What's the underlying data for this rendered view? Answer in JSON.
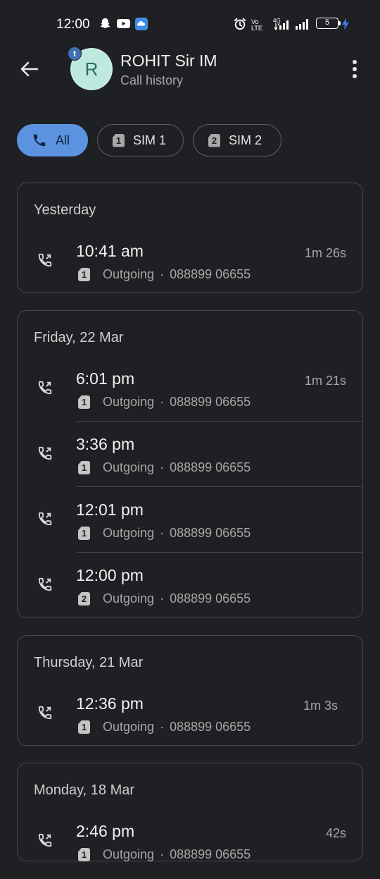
{
  "status_bar": {
    "time": "12:00",
    "network": "4G",
    "volte": "Vo LTE",
    "battery": "5"
  },
  "header": {
    "contact_name": "ROHIT Sir IM",
    "subtitle": "Call history",
    "avatar_letter": "R",
    "avatar_badge": "t"
  },
  "filters": [
    {
      "label": "All",
      "badge": ""
    },
    {
      "label": "SIM 1",
      "badge": "1"
    },
    {
      "label": "SIM 2",
      "badge": "2"
    }
  ],
  "groups": [
    {
      "date": "Yesterday",
      "calls": [
        {
          "time": "10:41 am",
          "sim": "1",
          "type": "Outgoing",
          "number": "088899 06655",
          "duration": "1m 26s"
        }
      ]
    },
    {
      "date": "Friday, 22 Mar",
      "calls": [
        {
          "time": "6:01 pm",
          "sim": "1",
          "type": "Outgoing",
          "number": "088899 06655",
          "duration": "1m 21s"
        },
        {
          "time": "3:36 pm",
          "sim": "1",
          "type": "Outgoing",
          "number": "088899 06655",
          "duration": ""
        },
        {
          "time": "12:01 pm",
          "sim": "1",
          "type": "Outgoing",
          "number": "088899 06655",
          "duration": ""
        },
        {
          "time": "12:00 pm",
          "sim": "2",
          "type": "Outgoing",
          "number": "088899 06655",
          "duration": ""
        }
      ]
    },
    {
      "date": "Thursday, 21 Mar",
      "calls": [
        {
          "time": "12:36 pm",
          "sim": "1",
          "type": "Outgoing",
          "number": "088899 06655",
          "duration": "1m 3s"
        }
      ]
    },
    {
      "date": "Monday, 18 Mar",
      "calls": [
        {
          "time": "2:46 pm",
          "sim": "1",
          "type": "Outgoing",
          "number": "088899 06655",
          "duration": "42s"
        }
      ]
    }
  ],
  "colors": {
    "background": "#1f2023",
    "accent": "#5b93e0",
    "avatar_bg": "#bfe8de"
  }
}
